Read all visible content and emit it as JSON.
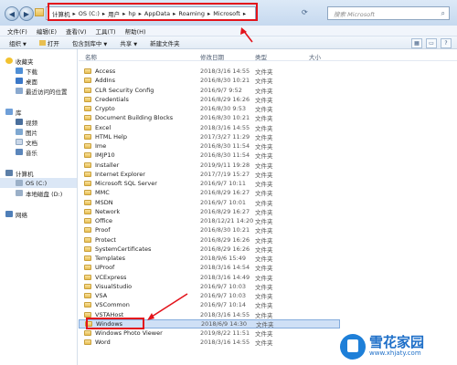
{
  "address_bar": {
    "segments": [
      "计算机",
      "OS (C:)",
      "用户",
      "hp",
      "AppData",
      "Roaming",
      "Microsoft"
    ],
    "search_placeholder": "搜索 Microsoft"
  },
  "menu": [
    "文件(F)",
    "编辑(E)",
    "查看(V)",
    "工具(T)",
    "帮助(H)"
  ],
  "toolbar": {
    "organize": "组织",
    "open": "打开",
    "include_in_library": "包含到库中",
    "share": "共享",
    "new_folder": "新建文件夹"
  },
  "nav": {
    "favorites": "收藏夹",
    "downloads": "下载",
    "desktop": "桌面",
    "recent": "最近访问的位置",
    "libraries": "库",
    "videos": "视频",
    "pictures": "图片",
    "documents": "文档",
    "music": "音乐",
    "computer": "计算机",
    "drive_c": "OS (C:)",
    "drive_d": "本地磁盘 (D:)",
    "network": "网络"
  },
  "columns": {
    "name": "名称",
    "date": "修改日期",
    "type": "类型",
    "size": "大小"
  },
  "files": [
    {
      "name": "Access",
      "date": "2018/3/16 14:55",
      "type": "文件夹"
    },
    {
      "name": "AddIns",
      "date": "2016/8/30 10:21",
      "type": "文件夹"
    },
    {
      "name": "CLR Security Config",
      "date": "2016/9/7 9:52",
      "type": "文件夹"
    },
    {
      "name": "Credentials",
      "date": "2016/8/29 16:26",
      "type": "文件夹"
    },
    {
      "name": "Crypto",
      "date": "2016/8/30 9:53",
      "type": "文件夹"
    },
    {
      "name": "Document Building Blocks",
      "date": "2016/8/30 10:21",
      "type": "文件夹"
    },
    {
      "name": "Excel",
      "date": "2018/3/16 14:55",
      "type": "文件夹"
    },
    {
      "name": "HTML Help",
      "date": "2017/3/27 11:29",
      "type": "文件夹"
    },
    {
      "name": "Ime",
      "date": "2016/8/30 11:54",
      "type": "文件夹"
    },
    {
      "name": "IMJP10",
      "date": "2016/8/30 11:54",
      "type": "文件夹"
    },
    {
      "name": "Installer",
      "date": "2019/9/11 19:28",
      "type": "文件夹"
    },
    {
      "name": "Internet Explorer",
      "date": "2017/7/19 15:27",
      "type": "文件夹"
    },
    {
      "name": "Microsoft SQL Server",
      "date": "2016/9/7 10:11",
      "type": "文件夹"
    },
    {
      "name": "MMC",
      "date": "2016/8/29 16:27",
      "type": "文件夹"
    },
    {
      "name": "MSDN",
      "date": "2016/9/7 10:01",
      "type": "文件夹"
    },
    {
      "name": "Network",
      "date": "2016/8/29 16:27",
      "type": "文件夹"
    },
    {
      "name": "Office",
      "date": "2018/12/21 14:20",
      "type": "文件夹"
    },
    {
      "name": "Proof",
      "date": "2016/8/30 10:21",
      "type": "文件夹"
    },
    {
      "name": "Protect",
      "date": "2016/8/29 16:26",
      "type": "文件夹"
    },
    {
      "name": "SystemCertificates",
      "date": "2016/8/29 16:26",
      "type": "文件夹"
    },
    {
      "name": "Templates",
      "date": "2018/9/6 15:49",
      "type": "文件夹"
    },
    {
      "name": "UProof",
      "date": "2018/3/16 14:54",
      "type": "文件夹"
    },
    {
      "name": "VCExpress",
      "date": "2018/3/16 14:49",
      "type": "文件夹"
    },
    {
      "name": "VisualStudio",
      "date": "2016/9/7 10:03",
      "type": "文件夹"
    },
    {
      "name": "VSA",
      "date": "2016/9/7 10:03",
      "type": "文件夹"
    },
    {
      "name": "VSCommon",
      "date": "2016/9/7 10:14",
      "type": "文件夹"
    },
    {
      "name": "VSTAHost",
      "date": "2018/3/16 14:55",
      "type": "文件夹"
    },
    {
      "name": "Windows",
      "date": "2018/6/9 14:30",
      "type": "文件夹"
    },
    {
      "name": "Windows Photo Viewer",
      "date": "2019/8/22 11:51",
      "type": "文件夹"
    },
    {
      "name": "Word",
      "date": "2018/3/16 14:55",
      "type": "文件夹"
    }
  ],
  "selected_file": "Windows",
  "watermark": {
    "title": "雪花家园",
    "url": "www.xhjaty.com"
  },
  "colors": {
    "annotation": "#e3131b",
    "selection": "#cfe0f6",
    "folder": "#e8bf52"
  }
}
